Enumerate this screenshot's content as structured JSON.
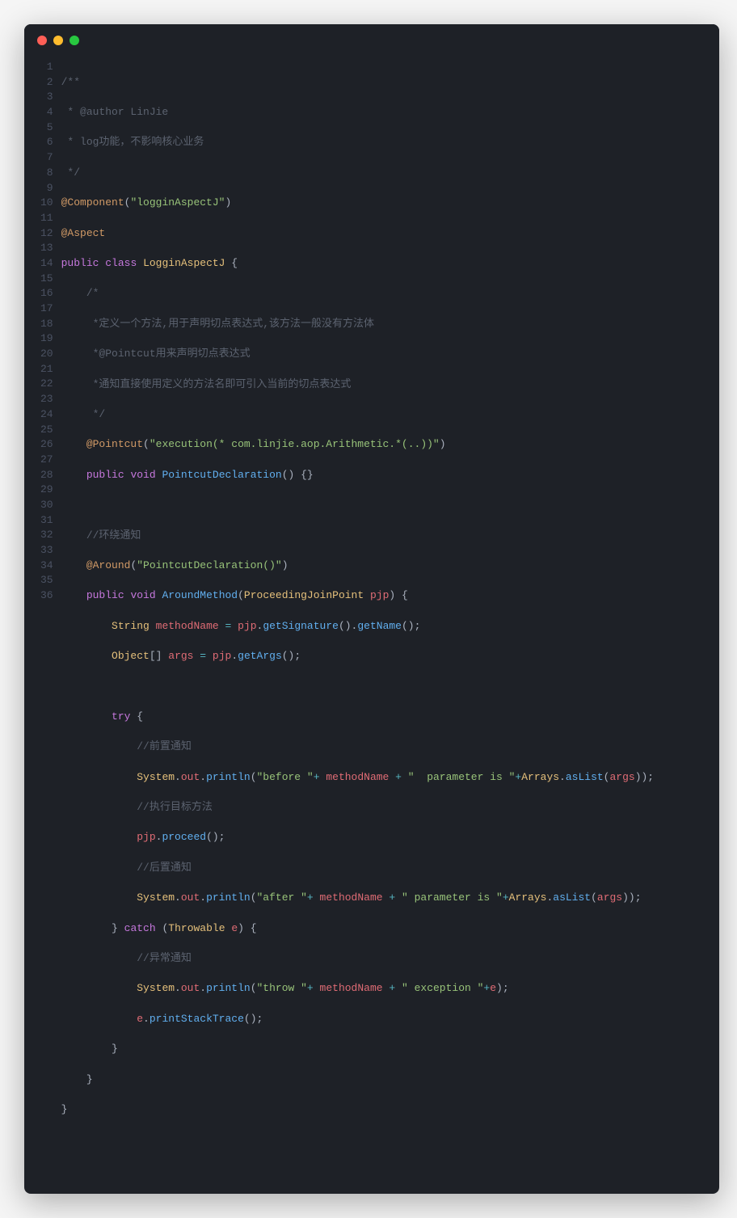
{
  "window": {
    "traffic_lights": [
      "red",
      "yellow",
      "green"
    ]
  },
  "code": {
    "line_count": 36,
    "lines": {
      "l1": "/**",
      "l2": " * @author LinJie",
      "l3": " * log功能，不影响核心业务",
      "l4": " */",
      "l5_annotation": "@Component",
      "l5_string": "\"logginAspectJ\"",
      "l6": "@Aspect",
      "l7_public": "public",
      "l7_class": "class",
      "l7_name": "LogginAspectJ",
      "l8": "    /*",
      "l9": "     *定义一个方法,用于声明切点表达式,该方法一般没有方法体",
      "l10": "     *@Pointcut用来声明切点表达式",
      "l11": "     *通知直接使用定义的方法名即可引入当前的切点表达式",
      "l12": "     */",
      "l13_ann": "@Pointcut",
      "l13_str": "\"execution(* com.linjie.aop.Arithmetic.*(..))\"",
      "l14_public": "public",
      "l14_void": "void",
      "l14_method": "PointcutDeclaration",
      "l16": "//环绕通知",
      "l17_ann": "@Around",
      "l17_str": "\"PointcutDeclaration()\"",
      "l18_public": "public",
      "l18_void": "void",
      "l18_method": "AroundMethod",
      "l18_type": "ProceedingJoinPoint",
      "l18_param": "pjp",
      "l19_type": "String",
      "l19_var": "methodName",
      "l19_pjp": "pjp",
      "l19_getSig": "getSignature",
      "l19_getName": "getName",
      "l20_type": "Object",
      "l20_var": "args",
      "l20_pjp": "pjp",
      "l20_getArgs": "getArgs",
      "l22_try": "try",
      "l23": "//前置通知",
      "l24_sys": "System",
      "l24_out": "out",
      "l24_println": "println",
      "l24_str1": "\"before \"",
      "l24_var1": "methodName",
      "l24_str2": "\"  parameter is \"",
      "l24_arrays": "Arrays",
      "l24_aslist": "asList",
      "l24_args": "args",
      "l25": "//执行目标方法",
      "l26_pjp": "pjp",
      "l26_proceed": "proceed",
      "l27": "//后置通知",
      "l28_sys": "System",
      "l28_out": "out",
      "l28_println": "println",
      "l28_str1": "\"after \"",
      "l28_var1": "methodName",
      "l28_str2": "\" parameter is \"",
      "l28_arrays": "Arrays",
      "l28_aslist": "asList",
      "l28_args": "args",
      "l29_catch": "catch",
      "l29_type": "Throwable",
      "l29_var": "e",
      "l30": "//异常通知",
      "l31_sys": "System",
      "l31_out": "out",
      "l31_println": "println",
      "l31_str1": "\"throw \"",
      "l31_var1": "methodName",
      "l31_str2": "\" exception \"",
      "l31_var2": "e",
      "l32_e": "e",
      "l32_pst": "printStackTrace"
    }
  }
}
